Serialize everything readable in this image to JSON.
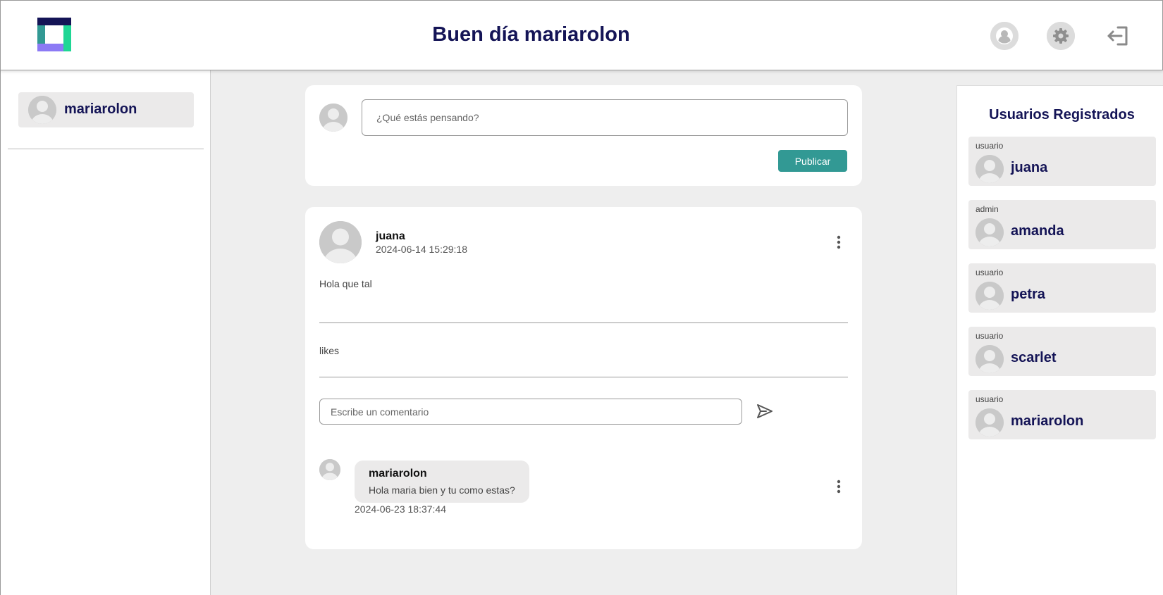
{
  "header": {
    "greeting": "Buen día mariarolon",
    "icons": [
      "logo-icon",
      "user-profile-icon",
      "gear-icon",
      "logout-icon"
    ]
  },
  "left_sidebar": {
    "current_user": "mariarolon"
  },
  "compose": {
    "placeholder": "¿Qué estás pensando?",
    "publish_label": "Publicar"
  },
  "post": {
    "author": "juana",
    "date": "2024-06-14 15:29:18",
    "body": "Hola que tal",
    "likes_label": "likes",
    "comment_placeholder": "Escribe un comentario",
    "comments": [
      {
        "author": "mariarolon",
        "text": "Hola maria bien y tu como estas?",
        "date": "2024-06-23 18:37:44"
      }
    ]
  },
  "right_sidebar": {
    "title": "Usuarios Registrados",
    "users": [
      {
        "role": "usuario",
        "name": "juana"
      },
      {
        "role": "admin",
        "name": "amanda"
      },
      {
        "role": "usuario",
        "name": "petra"
      },
      {
        "role": "usuario",
        "name": "scarlet"
      },
      {
        "role": "usuario",
        "name": "mariarolon"
      }
    ]
  },
  "colors": {
    "brand_navy": "#141456",
    "accent_teal": "#329994",
    "logo_green": "#1fd694",
    "logo_purple": "#8c7af5",
    "background": "#eeeeee"
  }
}
